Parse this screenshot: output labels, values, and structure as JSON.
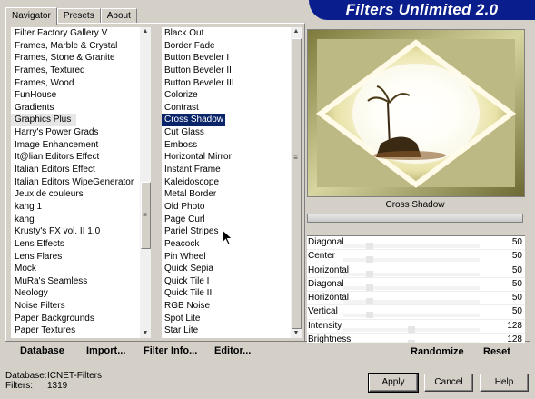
{
  "tabs": [
    "Navigator",
    "Presets",
    "About"
  ],
  "banner_title": "Filters Unlimited 2.0",
  "categories": [
    "Filter Factory Gallery V",
    "Frames, Marble & Crystal",
    "Frames, Stone & Granite",
    "Frames, Textured",
    "Frames, Wood",
    "FunHouse",
    "Gradients",
    "Graphics Plus",
    "Harry's Power Grads",
    "Image Enhancement",
    "It@lian Editors Effect",
    "Italian Editors Effect",
    "Italian Editors WipeGenerator",
    "Jeux de couleurs",
    "kang 1",
    "kang",
    "Krusty's FX vol. II 1.0",
    "Lens Effects",
    "Lens Flares",
    "Mock",
    "MuRa's Seamless",
    "Neology",
    "Noise Filters",
    "Paper Backgrounds",
    "Paper Textures"
  ],
  "selected_category": "Graphics Plus",
  "filters": [
    "Black Out",
    "Border Fade",
    "Button Beveler I",
    "Button Beveler II",
    "Button Beveler III",
    "Colorize",
    "Contrast",
    "Cross Shadow",
    "Cut Glass",
    "Emboss",
    "Horizontal Mirror",
    "Instant Frame",
    "Kaleidoscope",
    "Metal Border",
    "Old Photo",
    "Page Curl",
    "Pariel Stripes",
    "Peacock",
    "Pin Wheel",
    "Quick Sepia",
    "Quick Tile I",
    "Quick Tile II",
    "RGB Noise",
    "Spot Lite",
    "Star Lite"
  ],
  "selected_filter": "Cross Shadow",
  "toolbar": {
    "database": "Database",
    "import": "Import...",
    "filter_info": "Filter Info...",
    "editor": "Editor...",
    "randomize": "Randomize",
    "reset": "Reset"
  },
  "preview_label": "Cross Shadow",
  "params": [
    {
      "name": "Diagonal",
      "value": 50
    },
    {
      "name": "Center",
      "value": 50
    },
    {
      "name": "Horizontal",
      "value": 50
    },
    {
      "name": "Diagonal",
      "value": 50
    },
    {
      "name": "Horizontal",
      "value": 50
    },
    {
      "name": "Vertical",
      "value": 50
    },
    {
      "name": "Intensity",
      "value": 128
    },
    {
      "name": "Brightness",
      "value": 128
    }
  ],
  "status": {
    "database_label": "Database:",
    "database_value": "ICNET-Filters",
    "filters_label": "Filters:",
    "filters_value": "1319"
  },
  "buttons": {
    "apply": "Apply",
    "cancel": "Cancel",
    "help": "Help"
  },
  "colors": {
    "banner": "#0a1d8c",
    "selection": "#0a246a",
    "face": "#d4d0c8"
  }
}
